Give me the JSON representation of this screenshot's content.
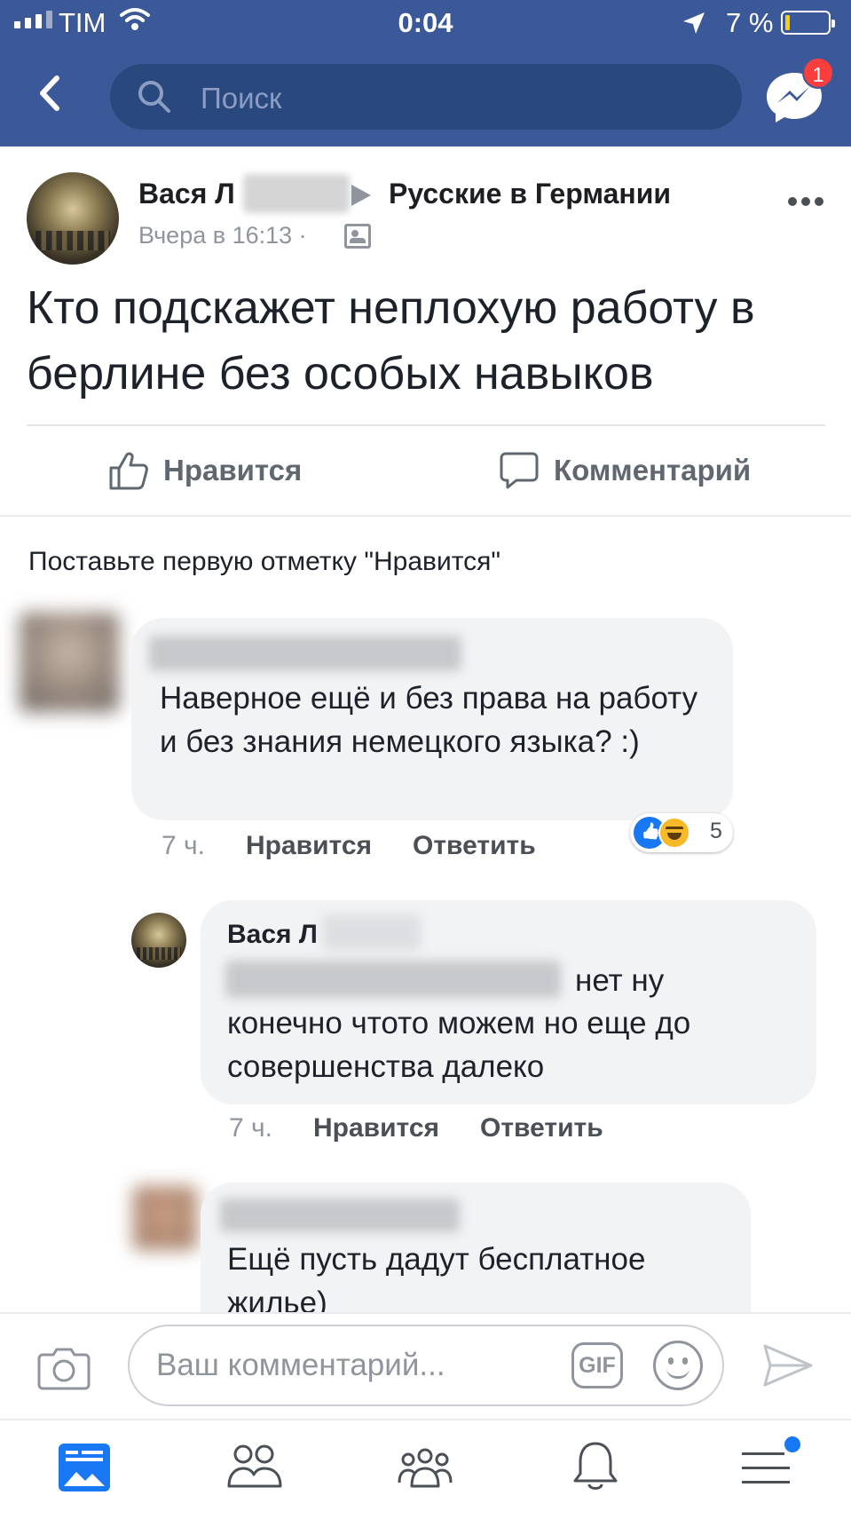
{
  "status_bar": {
    "carrier": "TIM",
    "time": "0:04",
    "battery_percent": "7 %",
    "battery_level": 0.07
  },
  "header": {
    "search_placeholder": "Поиск",
    "messenger_badge": "1"
  },
  "post": {
    "author_visible": "Вася Л",
    "group": "Русские в Германии",
    "time": "Вчера в 16:13 ·",
    "text": "Кто подскажет неплохую работу в берлине без особых навыков",
    "like_label": "Нравится",
    "comment_label": "Комментарий"
  },
  "first_like_prompt": "Поставьте первую отметку \"Нравится\"",
  "comments": [
    {
      "text": "Наверное ещё и без права на работу и без знания немецкого языка? :)",
      "time": "7 ч.",
      "like": "Нравится",
      "reply": "Ответить",
      "reaction_count": "5",
      "reactions": [
        "like",
        "haha"
      ]
    },
    {
      "author_visible": "Вася Л",
      "text_line1": "нет ну",
      "text_rest": "конечно чтото можем но еще до совершенства далеко",
      "time": "7 ч.",
      "like": "Нравится",
      "reply": "Ответить"
    },
    {
      "text": "Ещё пусть дадут бесплатное жилье)"
    }
  ],
  "composer": {
    "placeholder": "Ваш комментарий...",
    "gif": "GIF"
  },
  "tabs": [
    "news-feed",
    "friends",
    "groups",
    "notifications",
    "menu"
  ],
  "colors": {
    "header": "#3b5998",
    "search": "#29487d",
    "badge": "#fa3e3e",
    "active_tab": "#1877f2"
  }
}
